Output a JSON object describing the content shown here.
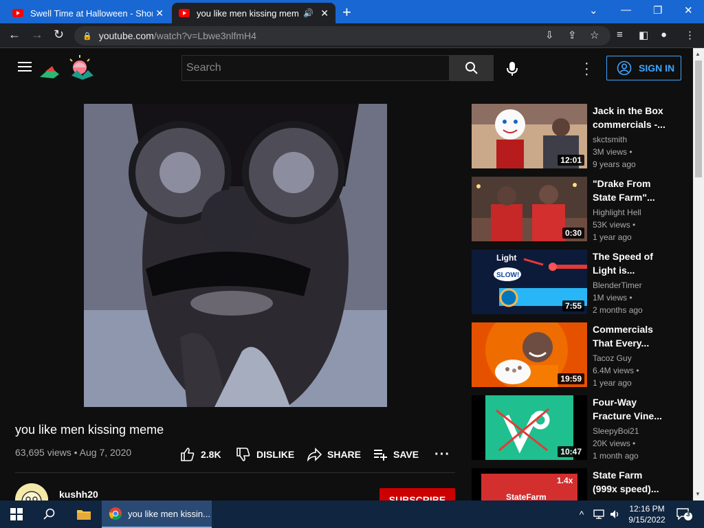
{
  "browser": {
    "tabs": [
      {
        "title": "Swell Time at Halloween - Short Fi",
        "active": false
      },
      {
        "title": "you like men kissing meme - Yo",
        "active": true
      }
    ],
    "url_host": "youtube.com",
    "url_path": "/watch?v=Lbwe3nlfmH4"
  },
  "youtube": {
    "search_placeholder": "Search",
    "signin_label": "SIGN IN",
    "video": {
      "title": "you like men kissing meme",
      "views": "63,695 views",
      "date": "Aug 7, 2020",
      "likes": "2.8K",
      "dislike_label": "DISLIKE",
      "share_label": "SHARE",
      "save_label": "SAVE",
      "channel": "kushh20",
      "subscribe_label": "SUBSCRIBE"
    },
    "recommendations": [
      {
        "title": "Jack in the Box commercials -...",
        "channel": "skctsmith",
        "views": "3M views",
        "age": "9 years ago",
        "duration": "12:01"
      },
      {
        "title": "\"Drake From State Farm\"...",
        "channel": "Highlight Hell",
        "views": "53K views",
        "age": "1 year ago",
        "duration": "0:30"
      },
      {
        "title": "The Speed of Light is...",
        "channel": "BlenderTimer",
        "views": "1M views",
        "age": "2 months ago",
        "duration": "7:55",
        "thumb_text_1": "Light",
        "thumb_text_2": "SLOW!"
      },
      {
        "title": "Commercials That Every...",
        "channel": "Tacoz Guy",
        "views": "6.4M views",
        "age": "1 year ago",
        "duration": "19:59"
      },
      {
        "title": "Four-Way Fracture Vine...",
        "channel": "SleepyBoi21",
        "views": "20K views",
        "age": "1 month ago",
        "duration": "10:47"
      },
      {
        "title": "State Farm (999x speed)...",
        "channel": "",
        "views": "",
        "age": "",
        "duration": "",
        "badge": "1.4x",
        "thumb_text_1": "StateFarm"
      }
    ]
  },
  "taskbar": {
    "chrome_label": "you like men kissin...",
    "time": "12:16 PM",
    "date": "9/15/2022",
    "notifications": "3"
  },
  "colors": {
    "tab_strip": "#1967d2",
    "yt_bg": "#0f0f0f",
    "accent_blue": "#3ea6ff",
    "subscribe_red": "#cc0000"
  }
}
